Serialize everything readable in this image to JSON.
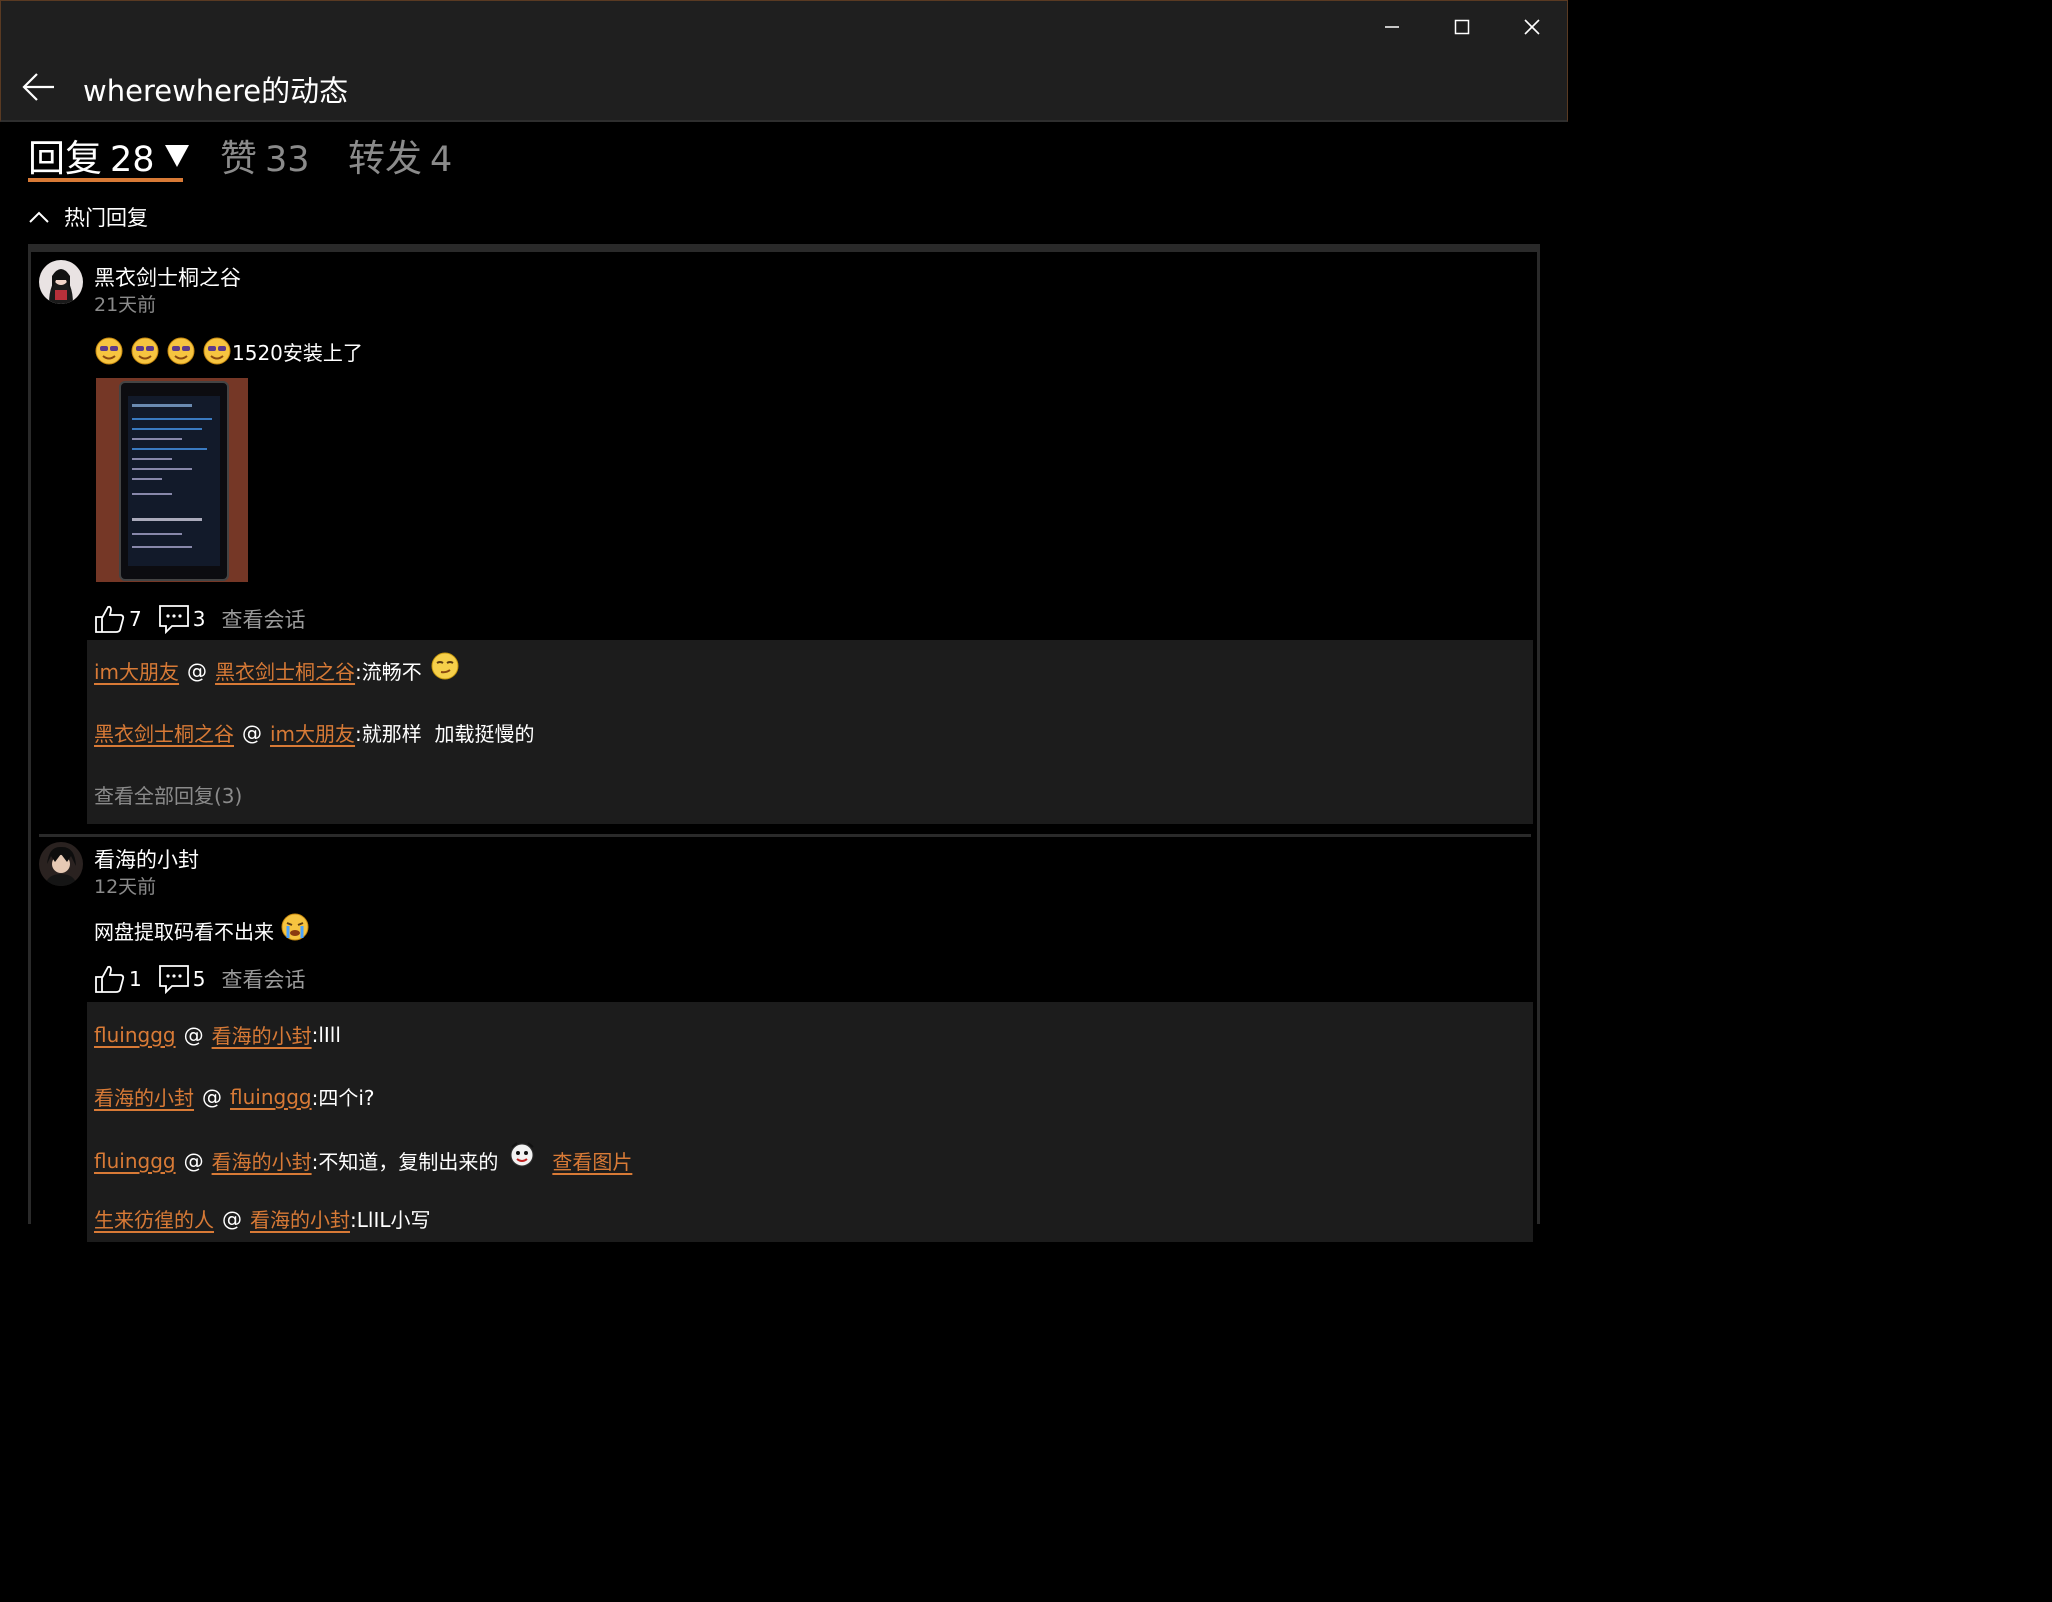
{
  "window": {
    "title": "wherewhere的动态"
  },
  "tabs": [
    {
      "label": "回复",
      "count": "28"
    },
    {
      "label": "赞",
      "count": "33"
    },
    {
      "label": "转发",
      "count": "4"
    }
  ],
  "hot_section": {
    "label": "热门回复"
  },
  "replies": [
    {
      "user": "黑衣剑士桐之谷",
      "time": "21天前",
      "text": "1520安装上了",
      "likes": "7",
      "comments": "3",
      "view_conversation": "查看会话",
      "sub_replies": [
        {
          "from": "im大朋友",
          "at": "@",
          "to": "黑衣剑士桐之谷",
          "text": ":流畅不"
        },
        {
          "from": "黑衣剑士桐之谷",
          "at": "@",
          "to": "im大朋友",
          "text": ":就那样  加载挺慢的"
        }
      ],
      "view_all": "查看全部回复(3)"
    },
    {
      "user": "看海的小封",
      "time": "12天前",
      "text": "网盘提取码看不出来",
      "likes": "1",
      "comments": "5",
      "view_conversation": "查看会话",
      "sub_replies": [
        {
          "from": "fluinggg",
          "at": "@",
          "to": "看海的小封",
          "text": ":lIll"
        },
        {
          "from": "看海的小封",
          "at": "@",
          "to": "fluinggg",
          "text": ":四个i?"
        },
        {
          "from": "fluinggg",
          "at": "@",
          "to": "看海的小封",
          "text": ":不知道，复制出来的",
          "link": "查看图片"
        },
        {
          "from": "生来彷徨的人",
          "at": "@",
          "to": "看海的小封",
          "text": ":LlIL小写"
        }
      ]
    }
  ],
  "colors": {
    "accent": "#d87a36",
    "background": "#000000",
    "panel": "#1c1c1c",
    "muted": "#8b8b8b"
  },
  "icons": [
    "minimize-icon",
    "maximize-icon",
    "close-icon",
    "back-arrow-icon",
    "chevron-up-icon",
    "thumbs-up-icon",
    "comment-icon"
  ]
}
